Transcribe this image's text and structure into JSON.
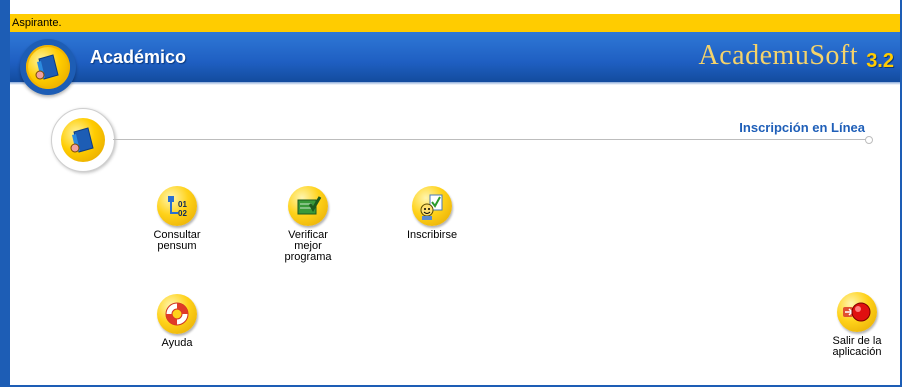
{
  "status": {
    "text": "Aspirante."
  },
  "header": {
    "module_title": "Académico",
    "brand": "AcademuSoft",
    "version": "3.2"
  },
  "section": {
    "title": "Inscripción en Línea"
  },
  "apps": [
    {
      "label": "Consultar\npensum",
      "icon": "pensum-icon"
    },
    {
      "label": "Verificar\nmejor\nprograma",
      "icon": "verify-program-icon"
    },
    {
      "label": "Inscribirse",
      "icon": "enroll-icon"
    },
    {
      "label": "Ayuda",
      "icon": "lifebuoy-icon"
    },
    {
      "label": "Salir de la\naplicación",
      "icon": "exit-icon"
    }
  ],
  "colors": {
    "frame_blue": "#1d5db5",
    "status_yellow": "#ffcc00",
    "section_title_blue": "#1f5fb8",
    "brand_gold": "#f5d36a"
  }
}
